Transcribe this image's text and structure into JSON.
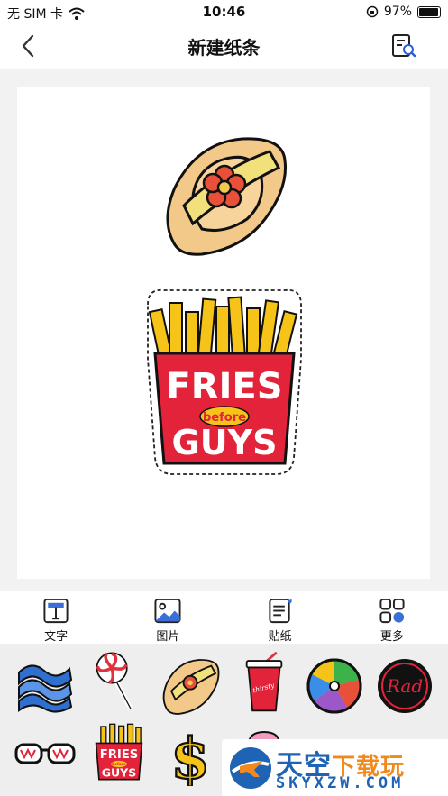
{
  "status": {
    "carrier": "无 SIM 卡",
    "time": "10:46",
    "battery_text": "97%",
    "battery_level": 0.97
  },
  "nav": {
    "title": "新建纸条",
    "back_icon": "chevron-left-icon",
    "preview_icon": "document-search-icon"
  },
  "stickers": {
    "fries_lines": [
      "FRIES",
      "before",
      "GUYS"
    ]
  },
  "toolbar": {
    "items": [
      {
        "label": "文字",
        "icon": "text-icon"
      },
      {
        "label": "图片",
        "icon": "image-icon"
      },
      {
        "label": "贴纸",
        "icon": "sticker-icon"
      },
      {
        "label": "更多",
        "icon": "more-grid-icon"
      }
    ]
  },
  "sticker_grid": {
    "items": [
      "waves",
      "lollipop",
      "sun-hat",
      "soda-cup",
      "beach-ball",
      "rad-badge",
      "sunglasses",
      "fries-before-guys",
      "dollar-sign",
      "ice-cream"
    ],
    "rad_text": "Rad",
    "fries_lines": [
      "FRIES",
      "before",
      "GUYS"
    ],
    "dollar_text": "$",
    "cup_text": "thirsty"
  },
  "watermark": {
    "title_main": "天空",
    "title_accent": "下载玩",
    "url": "SKYXZW.COM"
  },
  "colors": {
    "accent_blue": "#1e63b4",
    "accent_orange": "#f08a1e",
    "fries_red": "#e3233a",
    "fries_yellow": "#f6c419"
  }
}
